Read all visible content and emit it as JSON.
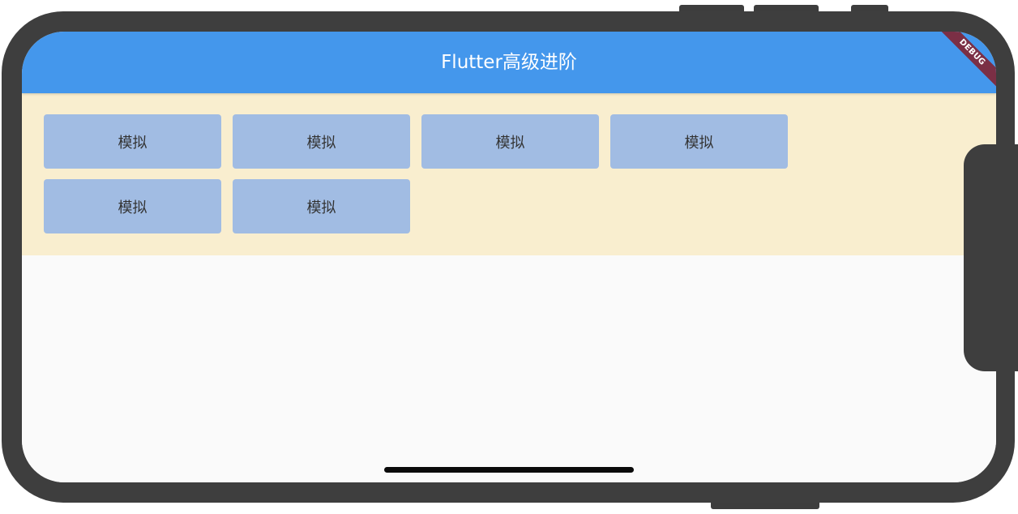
{
  "app_bar": {
    "title": "Flutter高级进阶"
  },
  "debug_banner": {
    "label": "DEBUG"
  },
  "wrap": {
    "buttons": [
      {
        "label": "模拟"
      },
      {
        "label": "模拟"
      },
      {
        "label": "模拟"
      },
      {
        "label": "模拟"
      },
      {
        "label": "模拟"
      },
      {
        "label": "模拟"
      }
    ]
  },
  "colors": {
    "app_bar": "#4497ec",
    "wrap_background": "#f9eecf",
    "button": "#a1bce3",
    "screen_background": "#fafafa",
    "debug_banner": "#7b2f45",
    "device_frame": "#3e3e3e"
  }
}
